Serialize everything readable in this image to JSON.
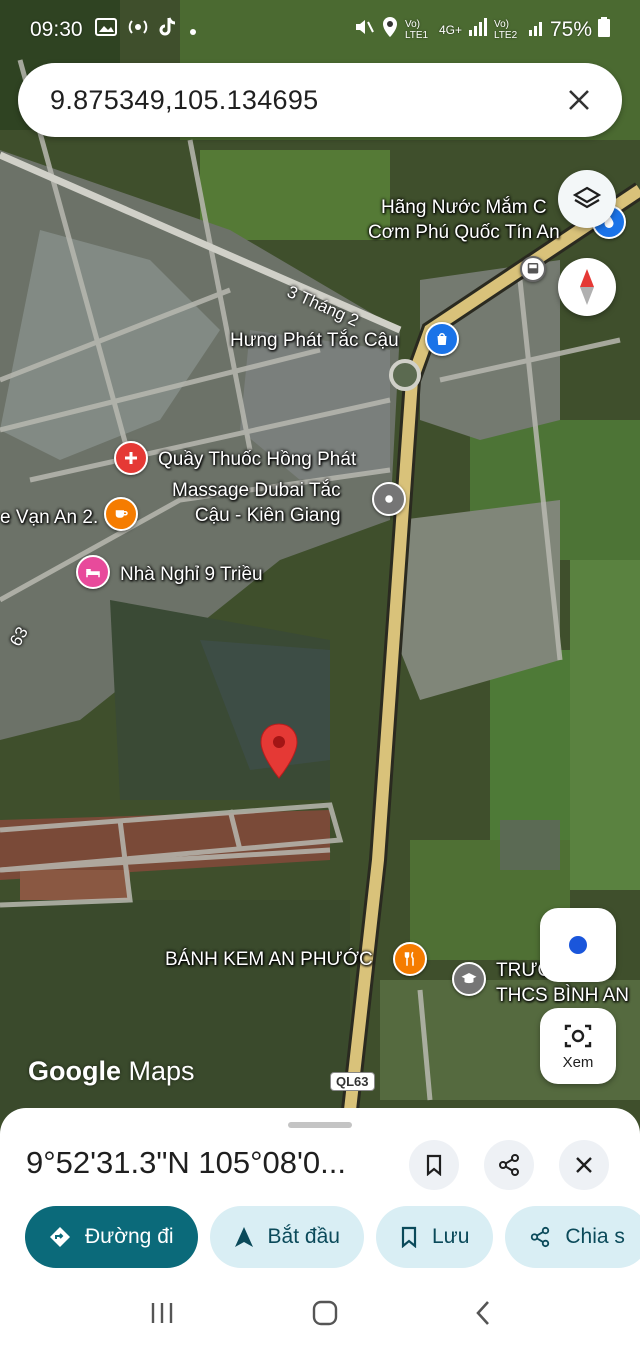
{
  "status_bar": {
    "time": "09:30",
    "battery": "75%",
    "sim1": "Vo) LTE1",
    "sim2": "Vo) LTE2",
    "network": "4G+",
    "icons": [
      "gallery-icon",
      "cast-icon",
      "tiktok-icon",
      "dot-icon",
      "mute-icon",
      "location-icon",
      "signal-icon",
      "battery-icon"
    ]
  },
  "search": {
    "query": "9.875349,105.134695",
    "clear_icon": "close-icon"
  },
  "map": {
    "places": [
      {
        "name": "Hãng Nước Mắm C\nCơm Phú Quốc Tín An",
        "icon": "drop-icon"
      },
      {
        "name": "Hưng Phát Tắc Cậu",
        "icon": "shopping-bag-icon"
      },
      {
        "name": "Quầy Thuốc Hồng Phát",
        "icon": "pharmacy-icon"
      },
      {
        "name": "Massage Dubai Tắc\nCậu - Kiên Giang",
        "icon": "place-icon"
      },
      {
        "name": "e Vạn An 2.",
        "icon": "cafe-icon"
      },
      {
        "name": "Nhà Nghỉ 9 Triều",
        "icon": "bed-icon"
      },
      {
        "name": "BÁNH KEM AN PHƯỚC",
        "icon": "restaurant-icon"
      },
      {
        "name": "TRƯỜ\nTHCS BÌNH AN",
        "icon": "school-icon"
      }
    ],
    "roads": [
      "3 Tháng 2",
      "63"
    ],
    "route_shield": "QL63",
    "logo_google": "Google",
    "logo_maps": "Maps",
    "colors": {
      "road_major": "#d9c27a",
      "pin": "#e53935",
      "pharmacy": "#e53935",
      "cafe": "#f57c00",
      "hotel": "#e84a9b",
      "place": "#757575",
      "shopping": "#1a73e8"
    }
  },
  "controls": {
    "layers": "layers-icon",
    "compass": "compass-icon",
    "my_location": "my-location-icon",
    "lens_label": "Xem"
  },
  "sheet": {
    "coordinates": "9°52'31.3\"N 105°08'0...",
    "actions": [
      "bookmark-icon",
      "share-icon",
      "close-icon"
    ],
    "chips": [
      {
        "label": "Đường đi",
        "icon": "directions-icon",
        "primary": true
      },
      {
        "label": "Bắt đầu",
        "icon": "navigation-icon",
        "primary": false
      },
      {
        "label": "Lưu",
        "icon": "bookmark-icon",
        "primary": false
      },
      {
        "label": "Chia s",
        "icon": "share-icon",
        "primary": false
      }
    ]
  },
  "navbar": [
    "recents-icon",
    "home-icon",
    "back-icon"
  ]
}
